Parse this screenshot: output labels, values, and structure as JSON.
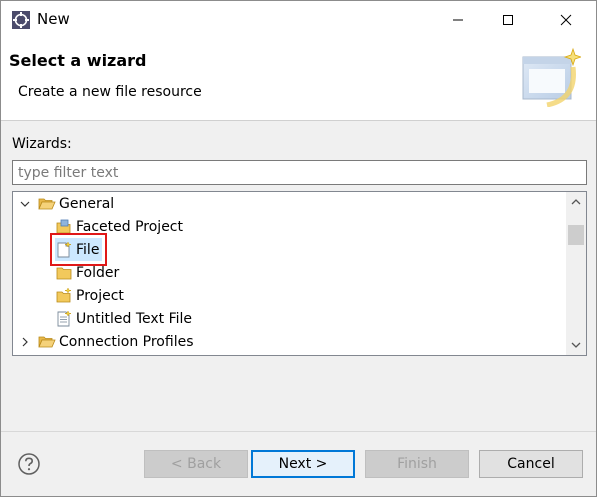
{
  "window": {
    "title": "New"
  },
  "banner": {
    "title": "Select a wizard",
    "description": "Create a new file resource"
  },
  "wizards": {
    "label": "Wizards:",
    "filter_placeholder": "type filter text",
    "filter_value": ""
  },
  "tree": {
    "items": [
      {
        "label": "General",
        "icon": "folder-open-icon",
        "expanded": true,
        "level": 0
      },
      {
        "label": "Faceted Project",
        "icon": "faceted-project-icon",
        "level": 1
      },
      {
        "label": "File",
        "icon": "new-file-icon",
        "level": 1,
        "selected": true
      },
      {
        "label": "Folder",
        "icon": "folder-icon",
        "level": 1
      },
      {
        "label": "Project",
        "icon": "project-icon",
        "level": 1
      },
      {
        "label": "Untitled Text File",
        "icon": "text-file-icon",
        "level": 1
      },
      {
        "label": "Connection Profiles",
        "icon": "folder-icon",
        "expanded": false,
        "level": 0
      }
    ]
  },
  "buttons": {
    "back": "< Back",
    "next": "Next >",
    "finish": "Finish",
    "cancel": "Cancel"
  },
  "colors": {
    "highlight_box": "#e01818",
    "selection": "#cce8ff",
    "default_button_border": "#0078d7"
  }
}
